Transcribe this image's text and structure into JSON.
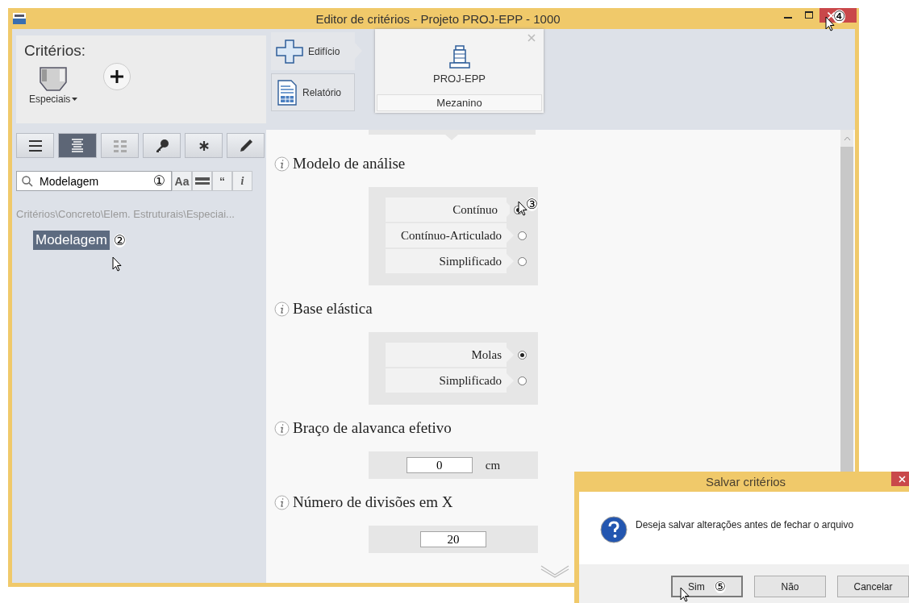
{
  "window": {
    "title": "Editor de critérios - Projeto PROJ-EPP - 1000",
    "annotation": "④"
  },
  "sidebar": {
    "heading": "Critérios:",
    "category": {
      "label": "Especiais"
    },
    "toolbar": [
      {
        "kind": "list",
        "selected": false
      },
      {
        "kind": "detail",
        "selected": true
      },
      {
        "kind": "grid",
        "selected": false
      },
      {
        "kind": "key",
        "selected": false
      },
      {
        "kind": "asterisk",
        "selected": false
      },
      {
        "kind": "pencil",
        "selected": false
      }
    ],
    "search": {
      "value": "Modelagem",
      "annotation": "①"
    },
    "search_options": [
      {
        "kind": "text",
        "label": "Aa"
      },
      {
        "kind": "bar"
      },
      {
        "kind": "text",
        "label": "“"
      },
      {
        "kind": "text",
        "label": "i"
      }
    ],
    "breadcrumb": "Critérios\\Concreto\\Elem. Estruturais\\Especiai...",
    "tree": [
      {
        "label": "Modelagem",
        "selected": true,
        "annotation": "②"
      }
    ]
  },
  "nav": {
    "buttons": [
      {
        "kind": "building",
        "label": "Edifício"
      },
      {
        "kind": "report",
        "label": "Relatório"
      }
    ],
    "project": {
      "name": "PROJ-EPP",
      "floor": "Mezanino"
    }
  },
  "sections": [
    {
      "kind": "radio",
      "title": "Modelo de análise",
      "options": [
        {
          "label": "Contínuo",
          "selected": true,
          "annotation": "③"
        },
        {
          "label": "Contínuo-Articulado",
          "selected": false
        },
        {
          "label": "Simplificado",
          "selected": false
        }
      ]
    },
    {
      "kind": "radio",
      "title": "Base elástica",
      "options": [
        {
          "label": "Molas",
          "selected": true
        },
        {
          "label": "Simplificado",
          "selected": false
        }
      ]
    },
    {
      "kind": "input",
      "title": "Braço de alavanca efetivo",
      "value": "0",
      "unit": "cm"
    },
    {
      "kind": "input",
      "title": "Número de divisões em X",
      "value": "20"
    }
  ],
  "dialog": {
    "title": "Salvar critérios",
    "message": "Deseja salvar alterações antes de fechar o arquivo",
    "buttons": [
      {
        "label": "Sim",
        "annotation": "⑤"
      },
      {
        "label": "Não"
      },
      {
        "label": "Cancelar"
      }
    ]
  }
}
